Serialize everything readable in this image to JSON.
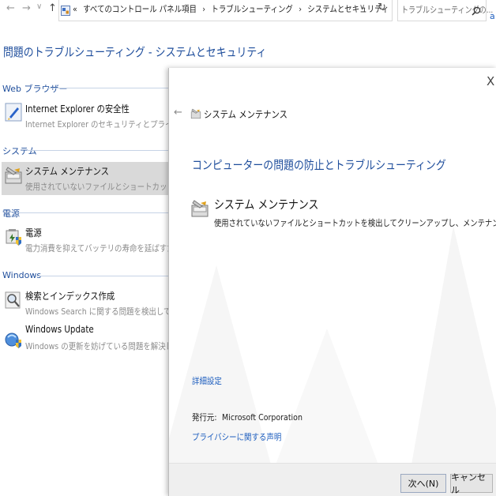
{
  "address_bar": {
    "back_glyph": "←",
    "forward_glyph": "→",
    "recent_glyph": "∨",
    "up_glyph": "↑",
    "overflow_glyph": "«",
    "crumbs": [
      {
        "label": "すべてのコントロール パネル項目"
      },
      {
        "label": "トラブルシューティング"
      },
      {
        "label": "システムとセキュリティ"
      }
    ],
    "separator": "›",
    "dropdown_glyph": "∨",
    "refresh_glyph": "↻",
    "search_placeholder": "トラブルシューティングの...",
    "search_icon": "search-icon",
    "edge_letter": "a"
  },
  "left_pane": {
    "title": "問題のトラブルシューティング - システムとセキュリティ",
    "sections": [
      {
        "name": "Web ブラウザー",
        "items": [
          {
            "title": "Internet Explorer の安全性",
            "desc": "Internet Explorer のセキュリティとプライバシーの機能",
            "icon": "internet-explorer-icon"
          }
        ]
      },
      {
        "name": "システム",
        "items": [
          {
            "title": "システム メンテナンス",
            "desc": "使用されていないファイルとショートカットを検出してク",
            "icon": "system-maintenance-icon",
            "selected": true
          }
        ]
      },
      {
        "name": "電源",
        "items": [
          {
            "title": "電源",
            "desc": "電力消費を抑えてバッテリの寿命を延ばすためのコン",
            "icon": "power-icon"
          }
        ]
      },
      {
        "name": "Windows",
        "items": [
          {
            "title": "検索とインデックス作成",
            "desc": "Windows Search に関する問題を検出して解決しま",
            "icon": "search-indexing-icon"
          },
          {
            "title": "Windows Update",
            "desc": "Windows の更新を妨げている問題を解決します。",
            "icon": "windows-update-icon"
          }
        ]
      }
    ]
  },
  "wizard": {
    "close_glyph": "X",
    "back_glyph": "←",
    "header_title": "システム メンテナンス",
    "heading": "コンピューターの問題の防止とトラブルシューティング",
    "item_title": "システム メンテナンス",
    "item_desc": "使用されていないファイルとショートカットを検出してクリーンアップし、メンテナンス タスクを実行します。",
    "advanced_link": "詳細設定",
    "publisher_label": "発行元:",
    "publisher_value": "Microsoft Corporation",
    "privacy_link": "プライバシーに関する声明",
    "next_button": "次へ(N)",
    "cancel_button": "キャンセル"
  },
  "colors": {
    "accent_blue": "#1f4e9c",
    "link_blue": "#1f5fbf",
    "selection_gray": "#d9d9d9",
    "desc_gray": "#8c8c8c"
  }
}
